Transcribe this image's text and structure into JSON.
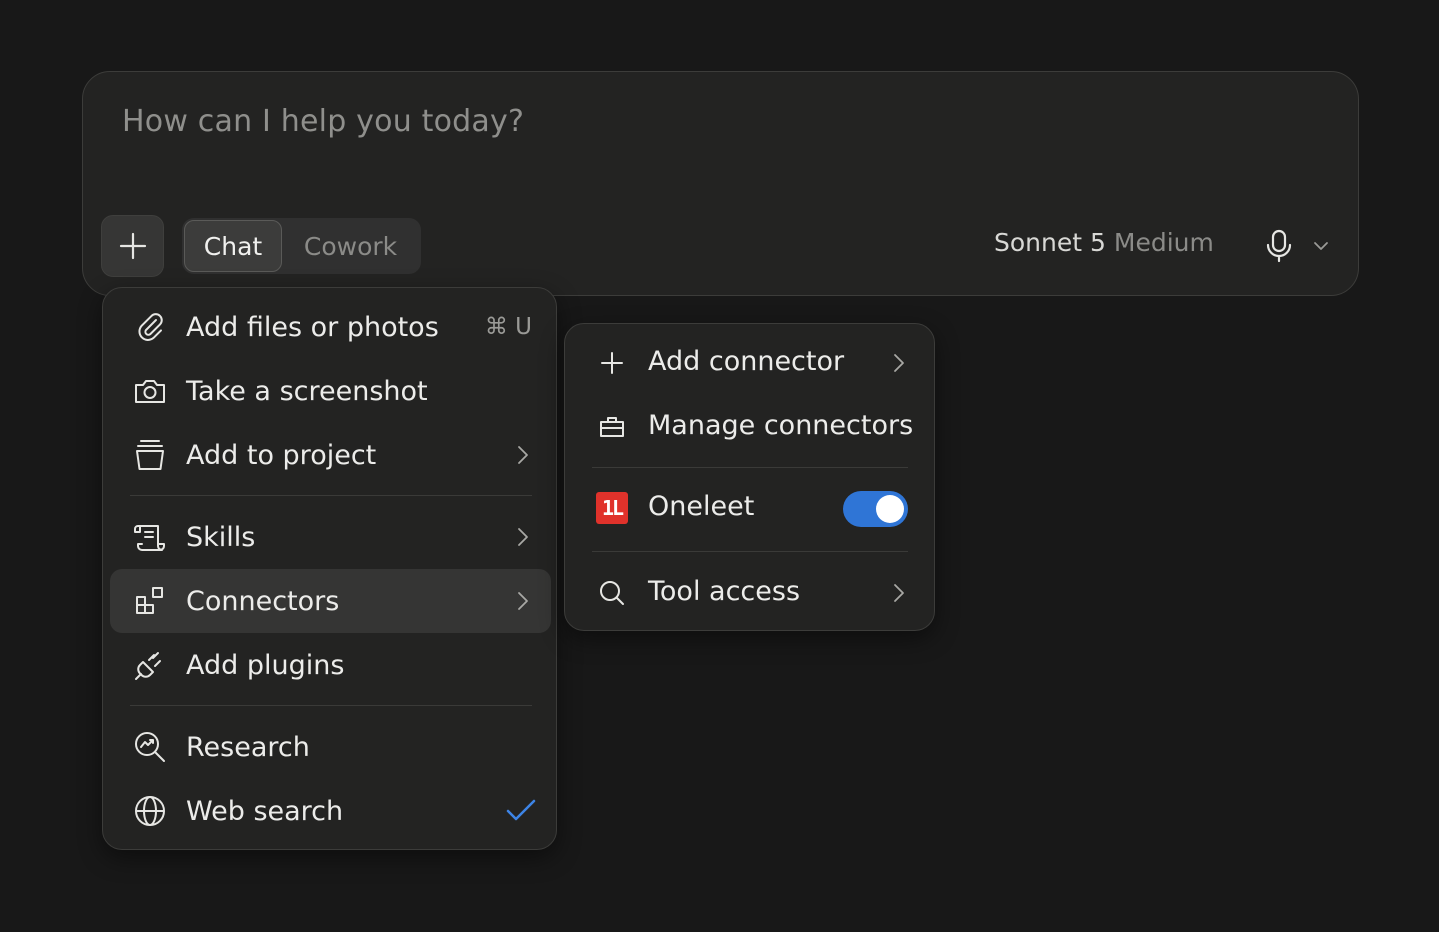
{
  "composer": {
    "placeholder": "How can I help you today?",
    "modes": {
      "chat": "Chat",
      "cowork": "Cowork",
      "selected": "Chat"
    },
    "model": {
      "name": "Sonnet 5",
      "effort": "Medium"
    }
  },
  "menu": {
    "items": [
      {
        "label": "Add files or photos",
        "icon": "paperclip-icon",
        "shortcut": "⌘ U"
      },
      {
        "label": "Take a screenshot",
        "icon": "camera-icon"
      },
      {
        "label": "Add to project",
        "icon": "project-icon",
        "has_submenu": true
      },
      {
        "label": "Skills",
        "icon": "scroll-icon",
        "has_submenu": true
      },
      {
        "label": "Connectors",
        "icon": "blocks-icon",
        "has_submenu": true,
        "active": true
      },
      {
        "label": "Add plugins",
        "icon": "plug-icon"
      },
      {
        "label": "Research",
        "icon": "research-icon"
      },
      {
        "label": "Web search",
        "icon": "globe-icon",
        "checked": true
      }
    ]
  },
  "connectors_submenu": {
    "items": [
      {
        "label": "Add connector",
        "icon": "plus-icon",
        "has_submenu": true
      },
      {
        "label": "Manage connectors",
        "icon": "briefcase-icon"
      },
      {
        "label": "Oneleet",
        "icon": "oneleet-logo",
        "logo_text": "1L",
        "enabled": true
      },
      {
        "label": "Tool access",
        "icon": "search-icon",
        "has_submenu": true
      }
    ]
  },
  "colors": {
    "background": "#181818",
    "surface": "#232322",
    "accent_blue": "#2f75d6",
    "oneleet_red": "#e0322b"
  }
}
